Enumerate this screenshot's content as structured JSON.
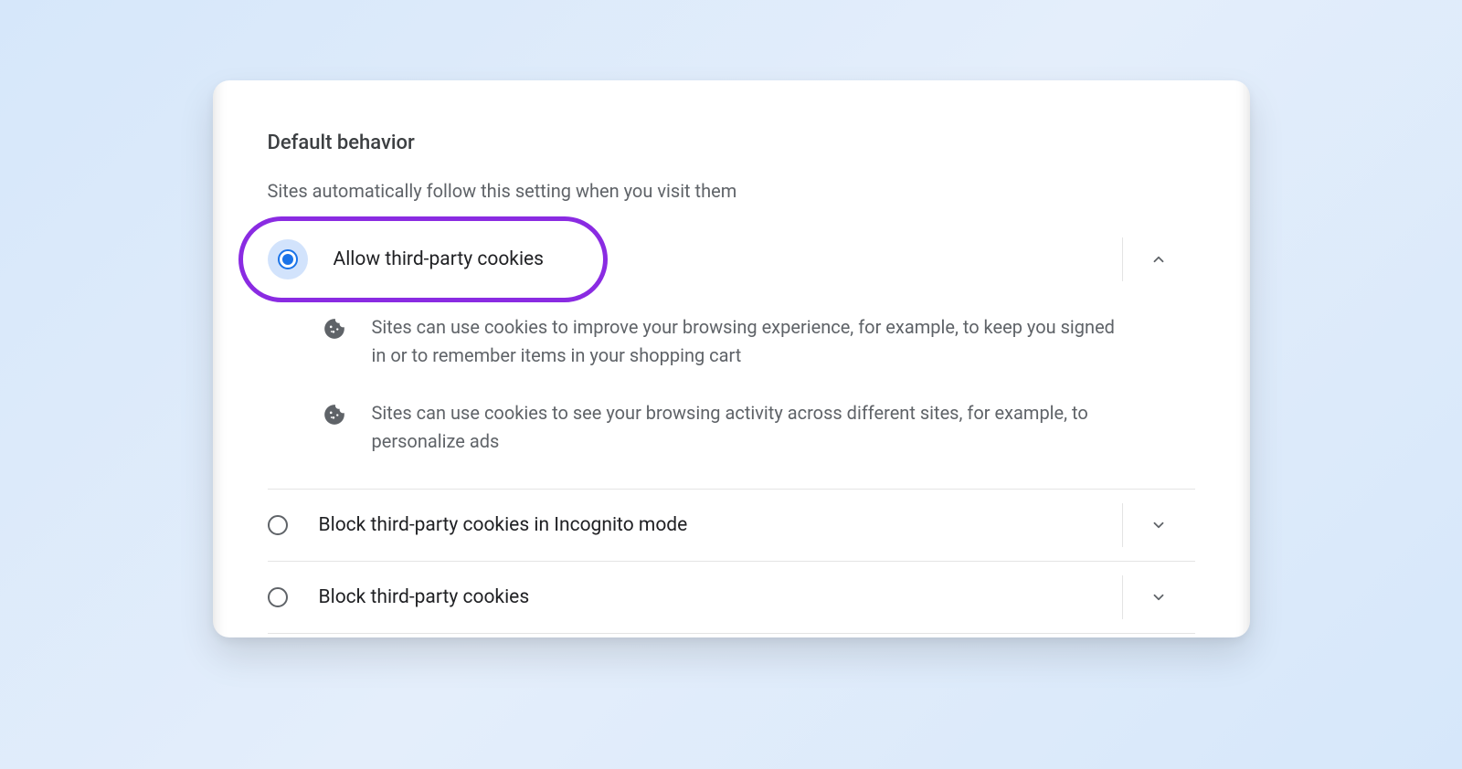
{
  "section": {
    "title": "Default behavior",
    "description": "Sites automatically follow this setting when you visit them"
  },
  "options": [
    {
      "label": "Allow third-party cookies",
      "selected": true,
      "expanded": true,
      "highlighted": true,
      "details": [
        "Sites can use cookies to improve your browsing experience, for example, to keep you signed in or to remember items in your shopping cart",
        "Sites can use cookies to see your browsing activity across different sites, for example, to personalize ads"
      ]
    },
    {
      "label": "Block third-party cookies in Incognito mode",
      "selected": false,
      "expanded": false
    },
    {
      "label": "Block third-party cookies",
      "selected": false,
      "expanded": false
    }
  ],
  "colors": {
    "accent": "#1a73e8",
    "highlight_border": "#8a2be2",
    "text_primary": "#202124",
    "text_secondary": "#5f6368"
  }
}
